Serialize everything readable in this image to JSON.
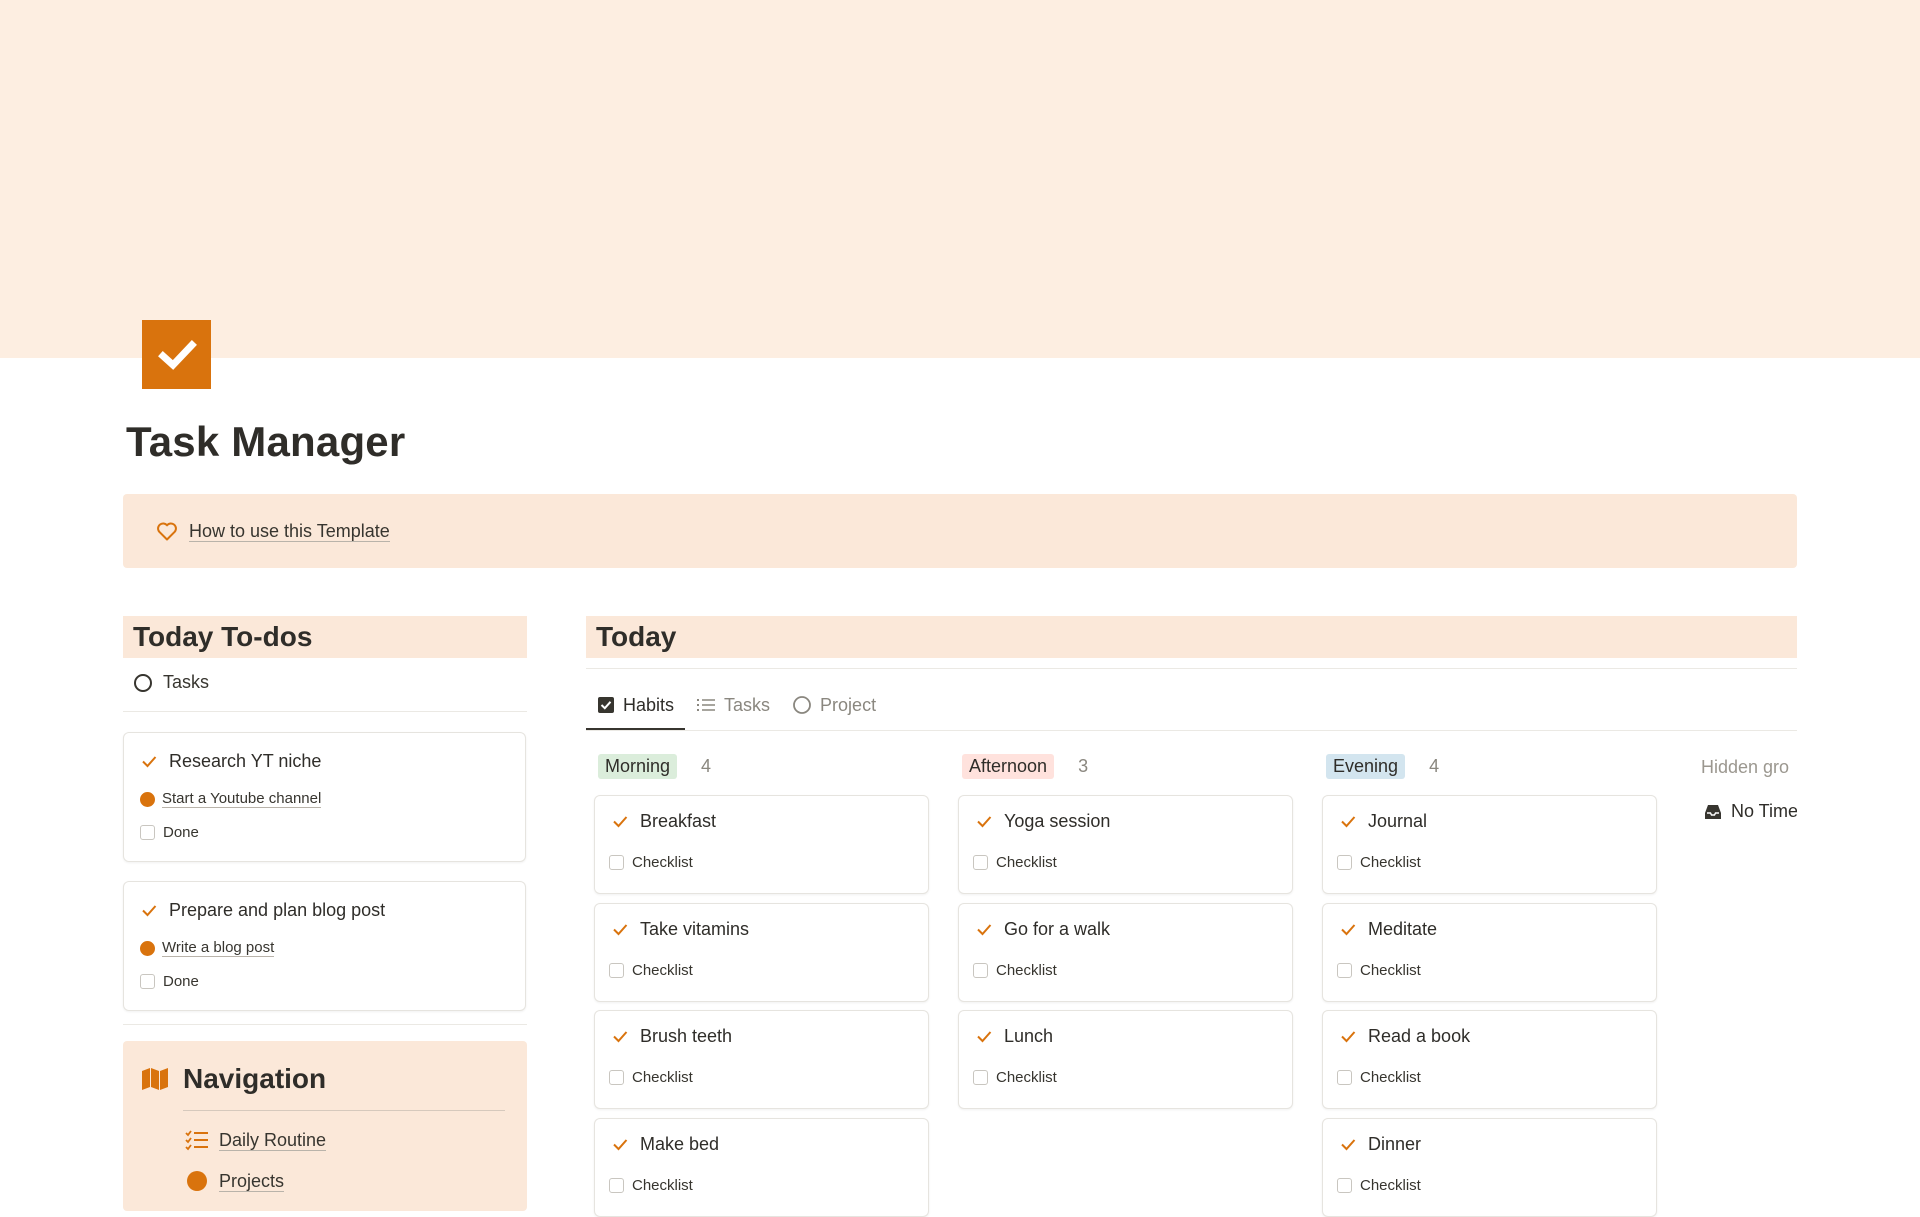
{
  "page": {
    "title": "Task Manager",
    "icon": "checkbox-icon",
    "accent": "#d9730d",
    "cover_color": "#fdeee1"
  },
  "callout": {
    "icon": "heart-icon",
    "link": "How to use this Template"
  },
  "todos": {
    "heading": "Today To-dos",
    "tab": "Tasks",
    "cards": [
      {
        "title": "Research YT niche",
        "project": "Start a Youtube channel",
        "checkbox_label": "Done"
      },
      {
        "title": "Prepare and plan blog post",
        "project": "Write a blog post",
        "checkbox_label": "Done"
      }
    ]
  },
  "navigation": {
    "title": "Navigation",
    "items": [
      {
        "label": "Daily Routine",
        "icon": "checklist-icon"
      },
      {
        "label": "Projects",
        "icon": "circle-icon"
      }
    ]
  },
  "today": {
    "heading": "Today",
    "views": [
      {
        "label": "Habits",
        "icon": "checkbox-icon",
        "active": true
      },
      {
        "label": "Tasks",
        "icon": "list-icon",
        "active": false
      },
      {
        "label": "Project",
        "icon": "circle-icon",
        "active": false
      }
    ],
    "groups": [
      {
        "name": "Morning",
        "count": "4",
        "color": "#dbeddb",
        "items": [
          {
            "title": "Breakfast",
            "checkbox_label": "Checklist"
          },
          {
            "title": "Take vitamins",
            "checkbox_label": "Checklist"
          },
          {
            "title": "Brush teeth",
            "checkbox_label": "Checklist"
          },
          {
            "title": "Make bed",
            "checkbox_label": "Checklist"
          }
        ]
      },
      {
        "name": "Afternoon",
        "count": "3",
        "color": "#ffe2dd",
        "items": [
          {
            "title": "Yoga session",
            "checkbox_label": "Checklist"
          },
          {
            "title": "Go for a walk",
            "checkbox_label": "Checklist"
          },
          {
            "title": "Lunch",
            "checkbox_label": "Checklist"
          }
        ]
      },
      {
        "name": "Evening",
        "count": "4",
        "color": "#d3e5ef",
        "items": [
          {
            "title": "Journal",
            "checkbox_label": "Checklist"
          },
          {
            "title": "Meditate",
            "checkbox_label": "Checklist"
          },
          {
            "title": "Read a book",
            "checkbox_label": "Checklist"
          },
          {
            "title": "Dinner",
            "checkbox_label": "Checklist"
          }
        ]
      }
    ],
    "hidden_groups_label": "Hidden gro",
    "no_time_label": "No Time"
  }
}
